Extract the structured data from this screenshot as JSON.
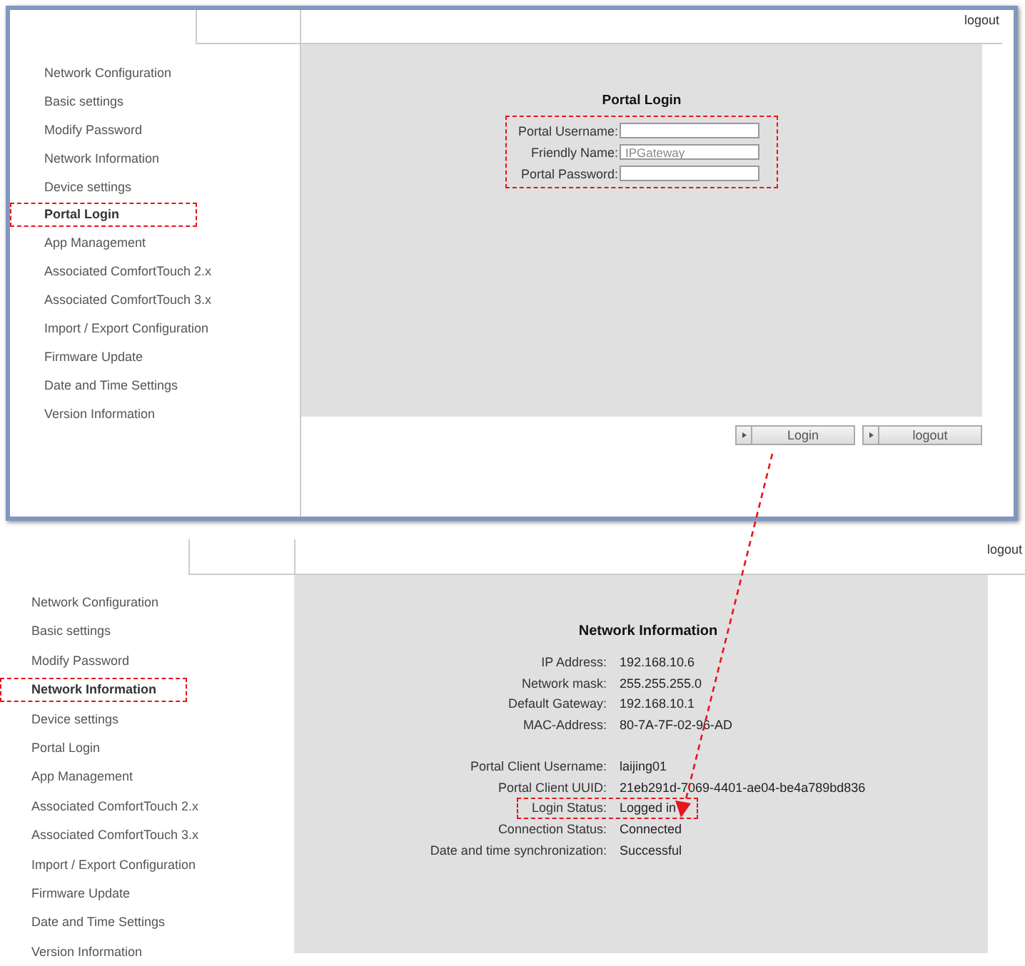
{
  "screens": [
    {
      "kind": "login",
      "logout": "logout",
      "menu": [
        {
          "label": "Network Configuration",
          "selected": false
        },
        {
          "label": "Basic settings",
          "selected": false
        },
        {
          "label": "Modify Password",
          "selected": false
        },
        {
          "label": "Network Information",
          "selected": false
        },
        {
          "label": "Device settings",
          "selected": false
        },
        {
          "label": "Portal Login",
          "selected": true
        },
        {
          "label": "App Management",
          "selected": false
        },
        {
          "label": "Associated ComfortTouch 2.x",
          "selected": false
        },
        {
          "label": "Associated ComfortTouch 3.x",
          "selected": false
        },
        {
          "label": "Import / Export Configuration",
          "selected": false
        },
        {
          "label": "Firmware Update",
          "selected": false
        },
        {
          "label": "Date and Time Settings",
          "selected": false
        },
        {
          "label": "Version Information",
          "selected": false
        }
      ],
      "title": "Portal Login",
      "form": {
        "highlighted": true,
        "fields": [
          {
            "label": "Portal Username:"
          },
          {
            "label": "Friendly Name:",
            "placeholder": "IPGateway"
          },
          {
            "label": "Portal Password:"
          }
        ]
      },
      "buttons": [
        "Login",
        "logout"
      ]
    },
    {
      "kind": "info",
      "logout": "logout",
      "menu": [
        {
          "label": "Network Configuration",
          "selected": false
        },
        {
          "label": "Basic settings",
          "selected": false
        },
        {
          "label": "Modify Password",
          "selected": false
        },
        {
          "label": "Network Information",
          "selected": true
        },
        {
          "label": "Device settings",
          "selected": false
        },
        {
          "label": "Portal Login",
          "selected": false
        },
        {
          "label": "App Management",
          "selected": false
        },
        {
          "label": "Associated ComfortTouch 2.x",
          "selected": false
        },
        {
          "label": "Associated ComfortTouch 3.x",
          "selected": false
        },
        {
          "label": "Import / Export Configuration",
          "selected": false
        },
        {
          "label": "Firmware Update",
          "selected": false
        },
        {
          "label": "Date and Time Settings",
          "selected": false
        },
        {
          "label": "Version Information",
          "selected": false
        }
      ],
      "title": "Network Information",
      "groups": [
        [
          {
            "label": "IP Address:",
            "value": "192.168.10.6",
            "highlighted": false
          },
          {
            "label": "Network mask:",
            "value": "255.255.255.0",
            "highlighted": false
          },
          {
            "label": "Default Gateway:",
            "value": "192.168.10.1",
            "highlighted": false
          },
          {
            "label": "MAC-Address:",
            "value": "80-7A-7F-02-96-AD",
            "highlighted": false
          }
        ],
        [
          {
            "label": "Portal Client Username:",
            "value": "laijing01",
            "highlighted": false
          },
          {
            "label": "Portal Client UUID:",
            "value": "21eb291d-7069-4401-ae04-be4a789bd836",
            "highlighted": false
          },
          {
            "label": "Login Status:",
            "value": "Logged in",
            "highlighted": true
          },
          {
            "label": "Connection Status:",
            "value": "Connected",
            "highlighted": false
          },
          {
            "label": "Date and time synchronization:",
            "value": "Successful",
            "highlighted": false
          }
        ]
      ]
    }
  ]
}
